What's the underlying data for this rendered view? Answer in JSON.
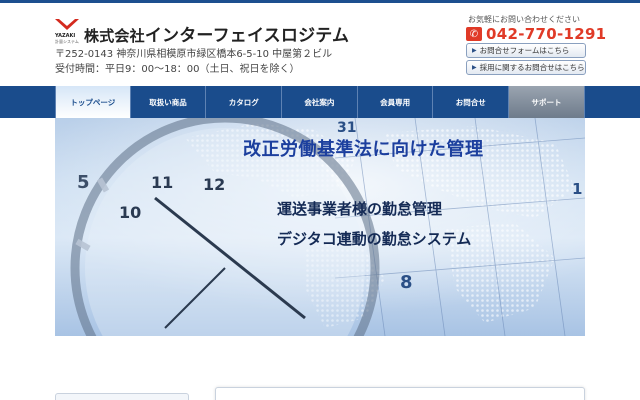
{
  "header": {
    "logo_text": "YAZAKI",
    "logo_sub": "計量システム",
    "company_prefix": "株式会社",
    "company_name": "インターフェイスロジテム",
    "address": "〒252-0143 神奈川県相模原市緑区橋本6-5-10 中屋第２ビル",
    "hours": "受付時間：平日9：00〜18：00（土日、祝日を除く）"
  },
  "contact": {
    "note": "お気軽にお問い合わせください",
    "phone_icon": "phone-icon",
    "phone": "042-770-1291",
    "form_button": "お問合せフォームはこちら",
    "recruit_button": "採用に関するお問合せはこちら"
  },
  "nav": {
    "items": [
      {
        "label": "トップページ"
      },
      {
        "label": "取扱い商品"
      },
      {
        "label": "カタログ"
      },
      {
        "label": "会社案内"
      },
      {
        "label": "会員専用"
      },
      {
        "label": "お問合せ"
      },
      {
        "label": "サポート"
      }
    ]
  },
  "hero": {
    "title": "改正労働基準法に向けた管理",
    "line1": "運送事業者様の勤怠管理",
    "line2": "デジタコ連動の勤怠システム",
    "clock_numbers": [
      "5",
      "10",
      "11",
      "12",
      "31",
      "1",
      "8"
    ]
  },
  "colors": {
    "brand": "#1a4c8c",
    "accent": "#e03a27",
    "hero_title": "#1c3f9e"
  }
}
